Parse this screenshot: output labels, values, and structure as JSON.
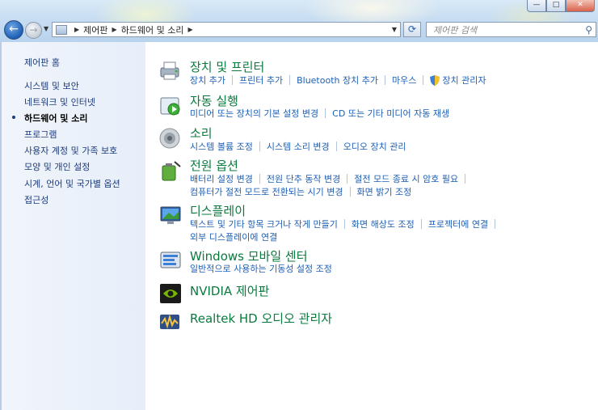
{
  "window": {
    "buttons": [
      "—",
      "□",
      "✕"
    ]
  },
  "breadcrumb": [
    "제어판",
    "하드웨어 및 소리"
  ],
  "search": {
    "placeholder": "제어판 검색"
  },
  "sidebar": {
    "home": "제어판 홈",
    "items": [
      "시스템 및 보안",
      "네트워크 및 인터넷",
      "하드웨어 및 소리",
      "프로그램",
      "사용자 계정 및 가족 보호",
      "모양 및 개인 설정",
      "시계, 언어 및 국가별 옵션",
      "접근성"
    ]
  },
  "categories": [
    {
      "title": "장치 및 프린터",
      "links": [
        [
          "장치 추가",
          "프린터 추가",
          "Bluetooth 장치 추가",
          "마우스",
          "장치 관리자"
        ]
      ]
    },
    {
      "title": "자동 실행",
      "links": [
        [
          "미디어 또는 장치의 기본 설정 변경",
          "CD 또는 기타 미디어 자동 재생"
        ]
      ]
    },
    {
      "title": "소리",
      "links": [
        [
          "시스템 볼륨 조정",
          "시스템 소리 변경",
          "오디오 장치 관리"
        ]
      ]
    },
    {
      "title": "전원 옵션",
      "links": [
        [
          "배터리 설정 변경",
          "전원 단추 동작 변경",
          "절전 모드 종료 시 암호 필요"
        ],
        [
          "컴퓨터가 절전 모드로 전환되는 시기 변경",
          "화면 밝기 조정"
        ]
      ]
    },
    {
      "title": "디스플레이",
      "links": [
        [
          "텍스트 및 기타 항목 크거나 작게 만들기",
          "화면 해상도 조정",
          "프로젝터에 연결"
        ],
        [
          "외부 디스플레이에 연결"
        ]
      ]
    },
    {
      "title": "Windows 모바일 센터",
      "links": [
        [
          "일반적으로 사용하는 기동성 설정 조정"
        ]
      ]
    },
    {
      "title": "NVIDIA 제어판",
      "links": []
    },
    {
      "title": "Realtek HD 오디오 관리자",
      "links": []
    }
  ],
  "colors": {
    "link": "#1e5fb4",
    "category_title": "#0b7a3e",
    "sidebar_link": "#1c3a7c"
  }
}
